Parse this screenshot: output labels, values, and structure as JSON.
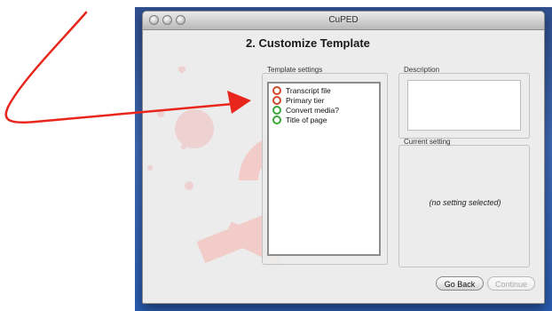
{
  "window": {
    "title": "CuPED"
  },
  "step": {
    "heading": "2. Customize Template"
  },
  "template_settings": {
    "label": "Template settings",
    "items": [
      {
        "label": "Transcript file",
        "status": "error"
      },
      {
        "label": "Primary tier",
        "status": "error"
      },
      {
        "label": "Convert media?",
        "status": "ok"
      },
      {
        "label": "Title of page",
        "status": "ok"
      }
    ]
  },
  "description": {
    "label": "Description"
  },
  "current_setting": {
    "label": "Current setting",
    "empty_text": "(no setting selected)"
  },
  "buttons": {
    "go_back": "Go Back",
    "continue": "Continue"
  },
  "colors": {
    "error": "#d2472b",
    "ok": "#3aa83a",
    "annotation_arrow": "#e8261c",
    "watermark": "#e9a6a0"
  }
}
